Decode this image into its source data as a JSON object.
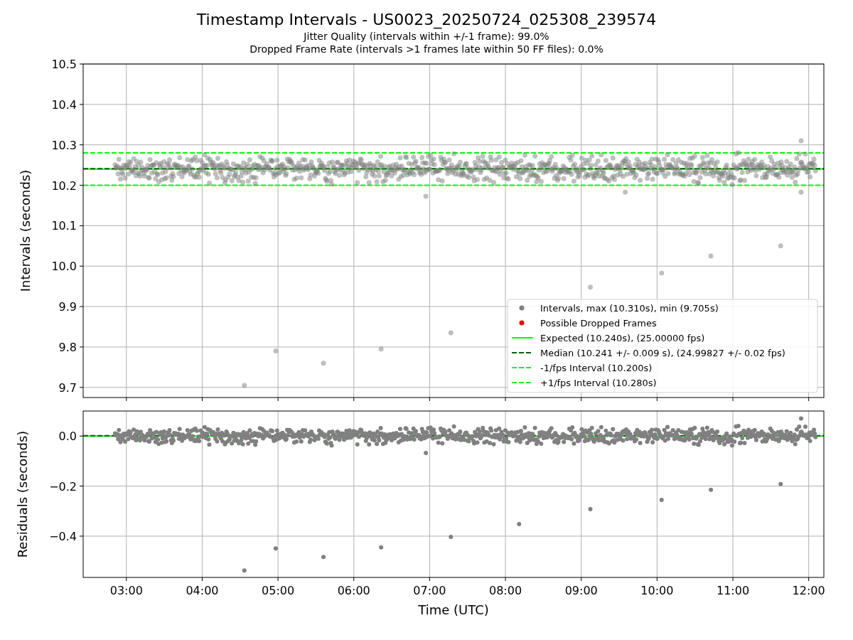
{
  "title": "Timestamp Intervals - US0023_20250724_025308_239574",
  "subtitles": [
    "Jitter Quality (intervals within +/-1 frame): 99.0%",
    "Dropped Frame Rate (intervals >1 frames late within 50 FF files): 0.0%"
  ],
  "intervals_plot": {
    "chart_data": {
      "type": "scatter",
      "ylabel": "Intervals (seconds)",
      "xlim": [
        2.43,
        12.2
      ],
      "ylim": [
        9.675,
        10.5
      ],
      "grid": true,
      "yticks": [
        {
          "value": 9.7,
          "label": "9.7"
        },
        {
          "value": 9.8,
          "label": "9.8"
        },
        {
          "value": 9.9,
          "label": "9.9"
        },
        {
          "value": 10.0,
          "label": "10.0"
        },
        {
          "value": 10.1,
          "label": "10.1"
        },
        {
          "value": 10.2,
          "label": "10.2"
        },
        {
          "value": 10.3,
          "label": "10.3"
        },
        {
          "value": 10.4,
          "label": "10.4"
        },
        {
          "value": 10.5,
          "label": "10.5"
        }
      ],
      "x": [
        4.556,
        4.97,
        5.6,
        6.36,
        6.95,
        7.28,
        9.12,
        9.58,
        10.06,
        10.71,
        11.63,
        11.9,
        11.9
      ],
      "series": [
        {
          "color": "#808080",
          "values": [
            9.705,
            9.79,
            9.76,
            9.795,
            10.173,
            9.835,
            9.948,
            10.183,
            9.983,
            10.025,
            10.05,
            10.31,
            10.183
          ]
        }
      ],
      "ref_lines": [
        {
          "axis": "y",
          "value": 10.24
        },
        {
          "axis": "y",
          "value": 10.241
        },
        {
          "axis": "y",
          "value": 10.2
        },
        {
          "axis": "y",
          "value": 10.28
        }
      ]
    },
    "legend": [
      {
        "kind": "dot",
        "color": "#808080",
        "label": "Intervals, max (10.310s), min (9.705s)"
      },
      {
        "kind": "dot",
        "color": "#ff0000",
        "label": "Possible Dropped Frames"
      },
      {
        "kind": "solid",
        "color": "#00ff00",
        "label": "Expected (10.240s), (25.00000 fps)"
      },
      {
        "kind": "dashed",
        "color": "#006400",
        "label": "Median (10.241 +/- 0.009 s), (24.99827 +/- 0.02 fps)"
      },
      {
        "kind": "dashed",
        "color": "#00ff00",
        "label": "-1/fps Interval (10.200s)"
      },
      {
        "kind": "dashed",
        "color": "#00ff00",
        "label": "+1/fps Interval (10.280s)"
      }
    ]
  },
  "residuals_plot": {
    "chart_data": {
      "type": "scatter",
      "xlabel": "Time (UTC)",
      "ylabel": "Residuals (seconds)",
      "xlim": [
        2.43,
        12.2
      ],
      "ylim": [
        -0.565,
        0.1
      ],
      "grid": true,
      "xticks": [
        {
          "value": 3,
          "label": "03:00"
        },
        {
          "value": 4,
          "label": "04:00"
        },
        {
          "value": 5,
          "label": "05:00"
        },
        {
          "value": 6,
          "label": "06:00"
        },
        {
          "value": 7,
          "label": "07:00"
        },
        {
          "value": 8,
          "label": "08:00"
        },
        {
          "value": 9,
          "label": "09:00"
        },
        {
          "value": 10,
          "label": "10:00"
        },
        {
          "value": 11,
          "label": "11:00"
        },
        {
          "value": 12,
          "label": "12:00"
        }
      ],
      "yticks": [
        {
          "value": 0,
          "label": "0.0"
        },
        {
          "value": -0.2,
          "label": "−0.2"
        },
        {
          "value": -0.4,
          "label": "−0.4"
        }
      ],
      "x": [
        4.556,
        4.97,
        5.6,
        6.36,
        6.95,
        7.28,
        8.18,
        9.12,
        10.06,
        10.71,
        11.63,
        11.9
      ],
      "series": [
        {
          "color": "#808080",
          "values": [
            -0.537,
            -0.449,
            -0.483,
            -0.445,
            -0.068,
            -0.403,
            -0.352,
            -0.292,
            -0.255,
            -0.215,
            -0.192,
            0.07
          ]
        }
      ],
      "ref_lines": [
        {
          "axis": "y",
          "value": 0
        },
        {
          "axis": "y",
          "value": 0.001
        }
      ]
    }
  }
}
